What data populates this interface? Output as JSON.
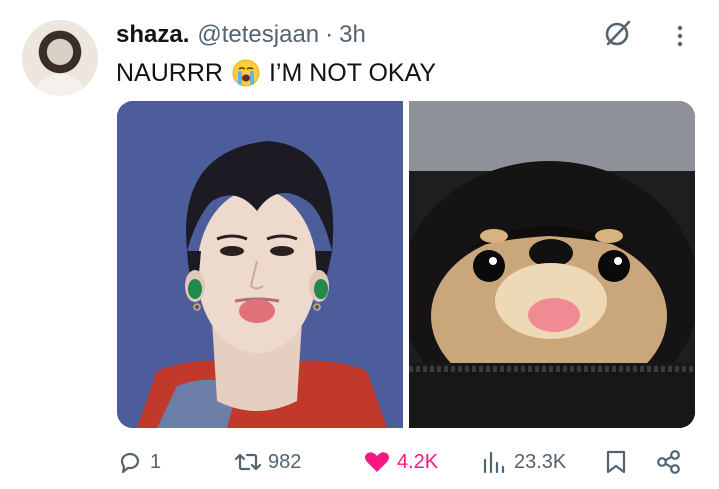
{
  "tweet": {
    "display_name": "shaza.",
    "handle": "@tetesjaan",
    "separator": "·",
    "time": "3h",
    "text_before": "NAURRR",
    "emoji": "loudly-crying-face",
    "text_after": "I’M NOT OKAY"
  },
  "media": {
    "left_image": "person-sticking-out-tongue",
    "right_image": "dog-sticking-out-tongue"
  },
  "actions": {
    "replies": "1",
    "reposts": "982",
    "likes": "4.2K",
    "views": "23.3K"
  },
  "colors": {
    "secondary_text": "#536471",
    "like": "#f91880",
    "primary_text": "#0f1419"
  },
  "icons": [
    "grok-icon",
    "more-icon",
    "reply-icon",
    "repost-icon",
    "heart-icon",
    "views-icon",
    "bookmark-icon",
    "share-icon"
  ]
}
